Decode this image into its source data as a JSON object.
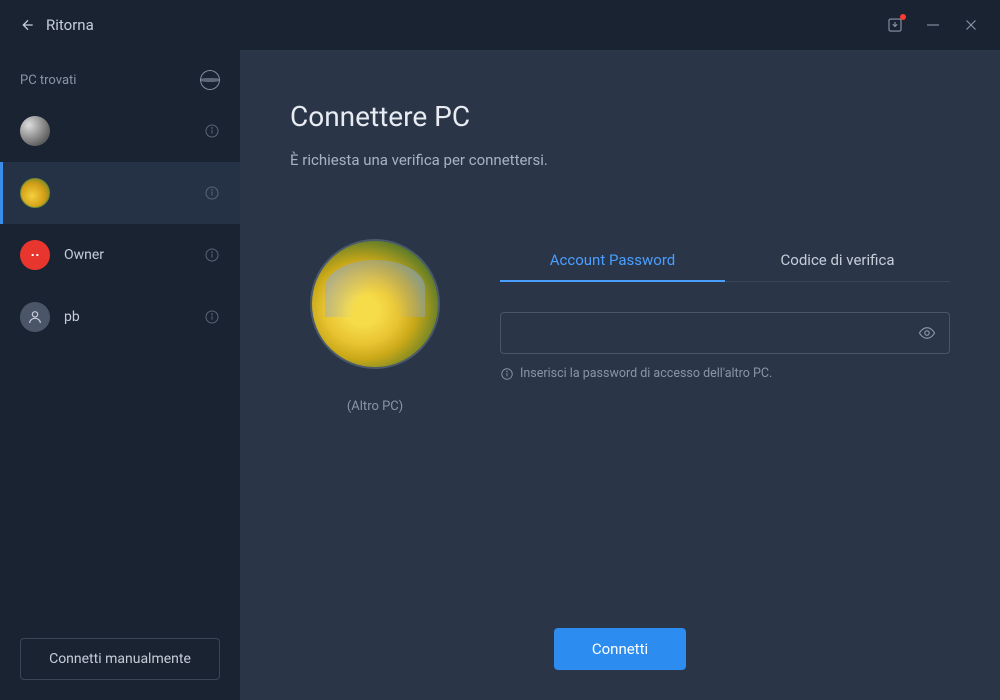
{
  "titlebar": {
    "back_label": "Ritorna"
  },
  "sidebar": {
    "header": "PC trovati",
    "items": [
      {
        "label": "",
        "avatar_type": "pattern"
      },
      {
        "label": "",
        "avatar_type": "flowers"
      },
      {
        "label": "Owner",
        "avatar_type": "red"
      },
      {
        "label": "pb",
        "avatar_type": "grey"
      }
    ],
    "manual_connect": "Connetti manualmente"
  },
  "content": {
    "title": "Connettere PC",
    "subtitle": "È richiesta una verifica per connettersi.",
    "avatar_caption": "(Altro PC)",
    "tabs": {
      "password": "Account Password",
      "code": "Codice di verifica"
    },
    "password_value": "",
    "hint": "Inserisci la password di accesso dell'altro PC.",
    "connect_button": "Connetti"
  }
}
